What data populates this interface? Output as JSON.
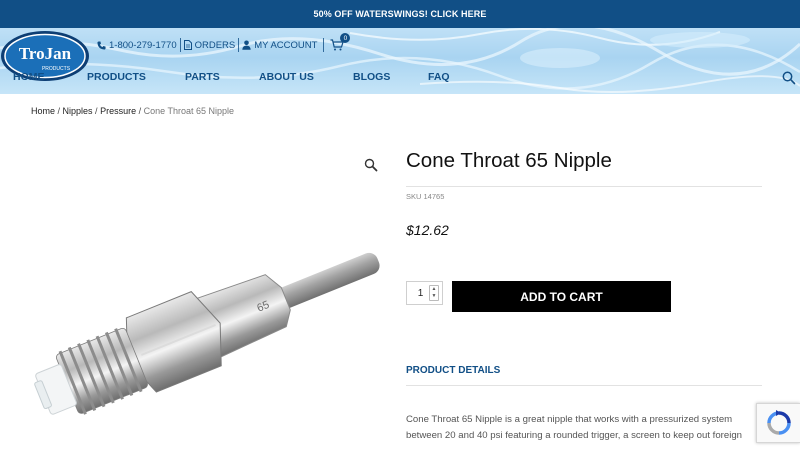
{
  "promo": {
    "text": "50% OFF WATERSWINGS! CLICK HERE"
  },
  "header": {
    "logo_text": "TroJan",
    "logo_subtext": "PRODUCTS",
    "phone": "1-800-279-1770",
    "orders": "ORDERS",
    "account": "MY ACCOUNT",
    "cart_count": "0"
  },
  "nav": {
    "items": [
      {
        "label": "HOME"
      },
      {
        "label": "PRODUCTS"
      },
      {
        "label": "PARTS"
      },
      {
        "label": "ABOUT US"
      },
      {
        "label": "BLOGS"
      },
      {
        "label": "FAQ"
      }
    ]
  },
  "breadcrumb": {
    "home": "Home",
    "sep": " / ",
    "nipples": "Nipples",
    "pressure": "Pressure",
    "current": "Cone Throat 65 Nipple"
  },
  "product": {
    "title": "Cone Throat 65 Nipple",
    "sku": "SKU 14765",
    "price": "$12.62",
    "quantity": "1",
    "add_to_cart": "ADD TO CART",
    "details_tab": "PRODUCT DETAILS",
    "description": "Cone Throat 65 Nipple is a great nipple that works with a pressurized system between 20 and 40 psi featuring a rounded trigger, a screen to keep out foreign"
  },
  "icons": {
    "phone": "phone-icon",
    "orders": "document-icon",
    "account": "user-icon",
    "cart": "cart-icon",
    "search": "search-icon",
    "zoom": "magnifier-icon",
    "recaptcha": "recaptcha-icon"
  },
  "colors": {
    "brand_blue": "#114f86",
    "button_black": "#000000",
    "header_water": "#b6dbf3"
  }
}
